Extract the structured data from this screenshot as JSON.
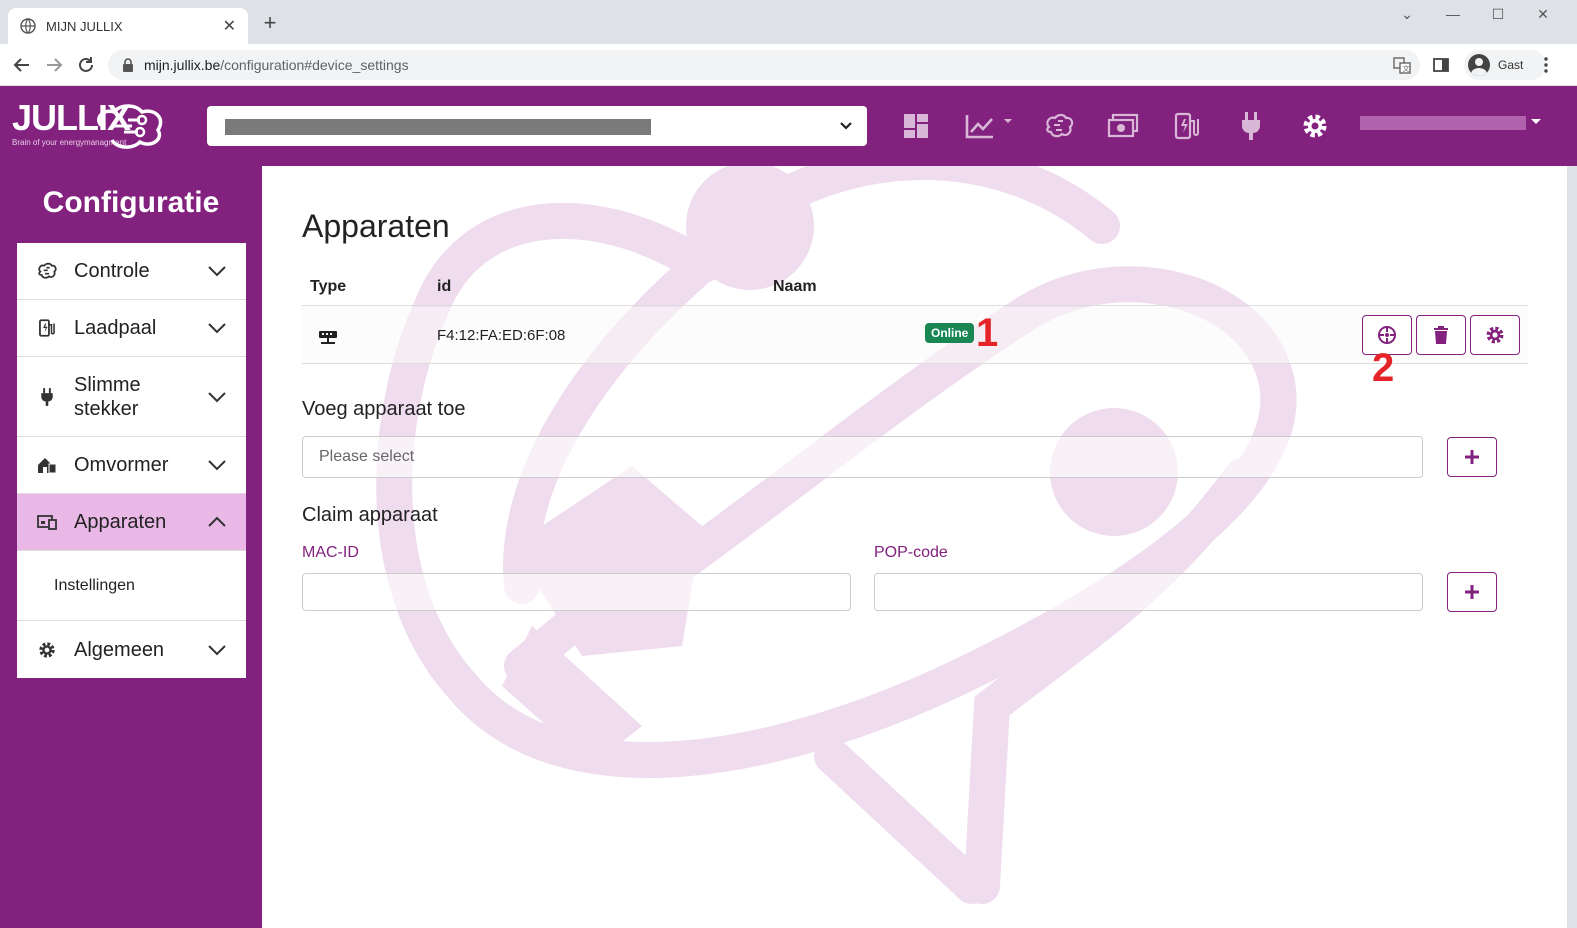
{
  "browser": {
    "tab_title": "MIJN JULLIX",
    "url_host": "mijn.jullix.be",
    "url_path": "/configuration#device_settings",
    "profile_name": "Gast"
  },
  "header": {
    "logo_text": "JULLIX",
    "logo_tagline": "Brain of your energymanagment",
    "brand_color": "#83217f"
  },
  "sidebar": {
    "title": "Configuratie",
    "items": [
      {
        "label": "Controle",
        "icon": "brain-icon"
      },
      {
        "label": "Laadpaal",
        "icon": "charging-station-icon"
      },
      {
        "label": "Slimme stekker",
        "icon": "plug-icon"
      },
      {
        "label": "Omvormer",
        "icon": "solar-home-icon"
      },
      {
        "label": "Apparaten",
        "icon": "devices-icon"
      },
      {
        "label": "Algemeen",
        "icon": "gear-icon"
      }
    ],
    "submenu_label": "Instellingen"
  },
  "main": {
    "page_title": "Apparaten",
    "table": {
      "headers": [
        "Type",
        "id",
        "Naam"
      ],
      "rows": [
        {
          "id": "F4:12:FA:ED:6F:08",
          "status": "Online"
        }
      ]
    },
    "annotations": [
      "1",
      "2"
    ],
    "add_section": {
      "title": "Voeg apparaat toe",
      "placeholder": "Please select"
    },
    "claim_section": {
      "title": "Claim apparaat",
      "mac_label": "MAC-ID",
      "pop_label": "POP-code"
    },
    "status_color": "#198754"
  }
}
